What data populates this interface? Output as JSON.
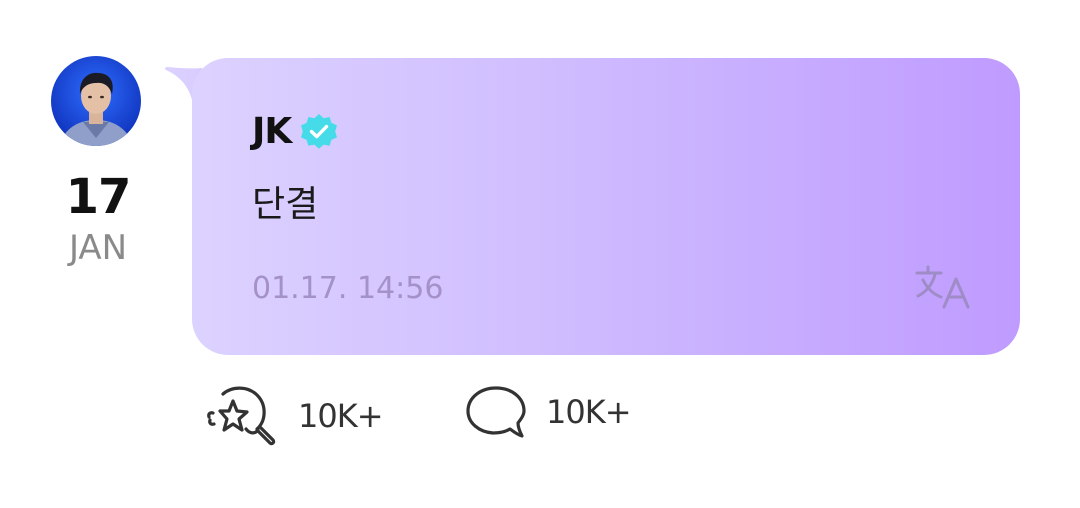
{
  "post": {
    "author": "JK",
    "date_day": "17",
    "date_month": "JAN",
    "message": "단결",
    "timestamp": "01.17. 14:56"
  },
  "reactions": {
    "likes": "10K+",
    "comments": "10K+"
  },
  "icons": {
    "verified": "verified-badge-icon",
    "translate": "translate-icon",
    "like": "lightstick-like-icon",
    "comment": "speech-bubble-icon"
  },
  "colors": {
    "bubble_start": "#dcd2ff",
    "bubble_end": "#bf9bff",
    "verified_badge": "#46dbe8",
    "timestamp": "#a391c7",
    "translate_icon": "#9f8cc6"
  }
}
